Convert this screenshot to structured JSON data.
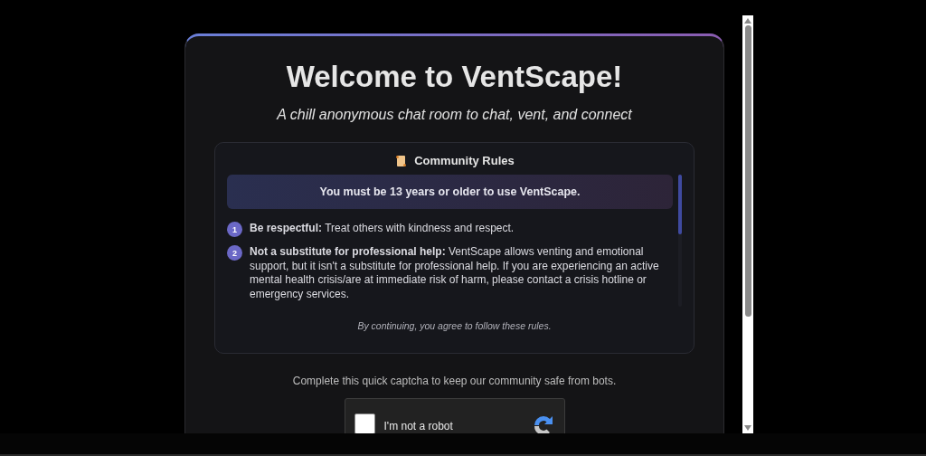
{
  "dialog": {
    "title": "Welcome to VentScape!",
    "subtitle": "A chill anonymous chat room to chat, vent, and connect"
  },
  "rules": {
    "heading": "Community Rules",
    "notice": "You must be 13 years or older to use VentScape.",
    "items": [
      {
        "number": "1",
        "text": "**Be respectful:** Treat others with kindness and respect."
      },
      {
        "number": "2",
        "text": "**Not a substitute for professional help:** VentScape allows venting and emotional support, but it isn't a substitute for professional help. If you are experiencing an active mental health crisis/are at immediate risk of harm, please contact a crisis hotline or emergency services."
      }
    ],
    "footer": "By continuing, you agree to follow these rules."
  },
  "captcha": {
    "prompt": "Complete this quick captcha to keep our community safe from bots.",
    "label": "I'm not a robot",
    "checked": false
  }
}
